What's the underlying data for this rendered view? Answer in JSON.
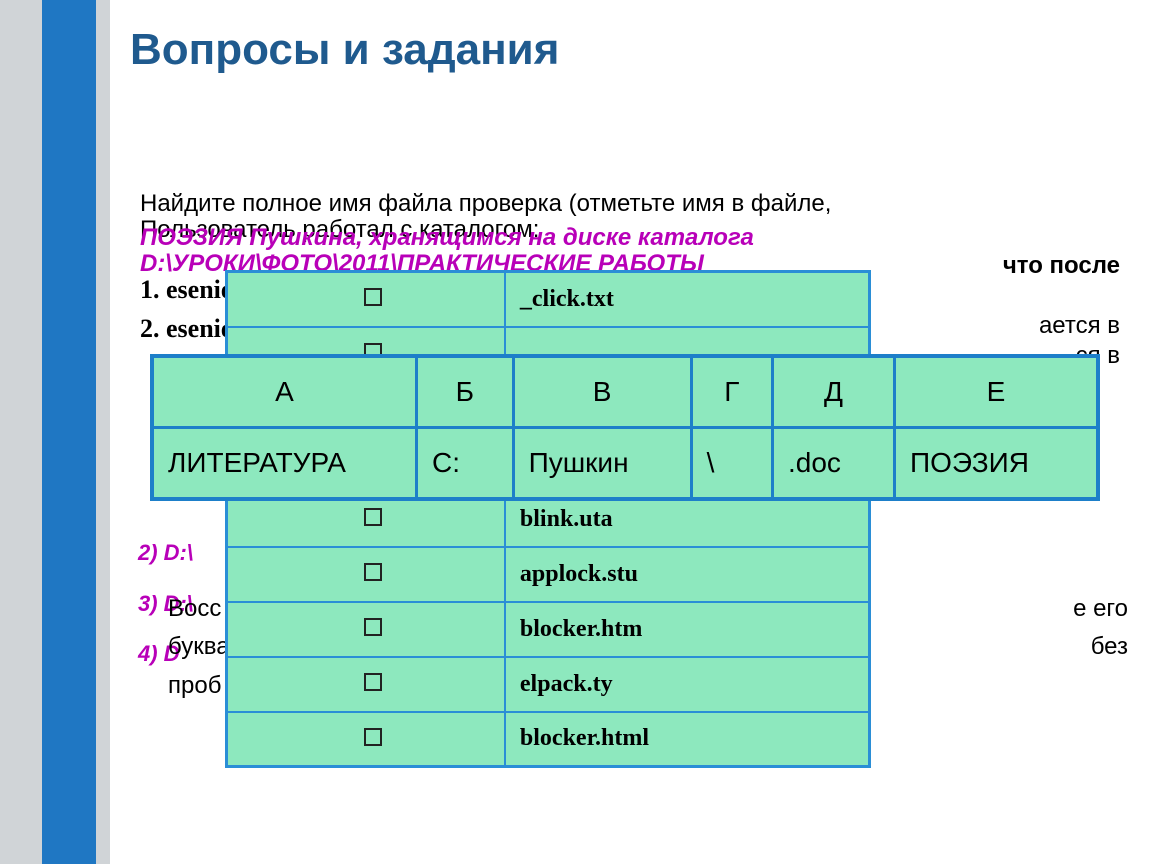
{
  "title": "Вопросы и задания",
  "bg_line1": "Найдите полное имя файла проверка (отметьте имя в файле,",
  "bg_line2": "Пользователь работал с каталогом:",
  "bg_line3": "ПОЭЗИЯ Пушкина, хранящимся на диске каталога",
  "bg_line4": "D:\\УРОКИ\\ФОТО\\2011\\ПРАКТИЧЕСКИЕ РАБОТЫ",
  "bg_line5": "что после",
  "bg_line6": "ается в",
  "bg_line7": "ся в",
  "numbered": [
    "2) D:\\",
    "3) D:\\",
    "4) D"
  ],
  "ess_rows": [
    "1. esenie.ttx",
    "2. esenie.ttx"
  ],
  "vosst_line1": "Восс",
  "vosst_line2": "е его",
  "vosst_line3": "буква",
  "vosst_line4": "без",
  "vosst_line5": "проб",
  "filetable": {
    "rows": [
      "_click.txt",
      "",
      "",
      "",
      "blink.uta",
      "applock.stu",
      "blocker.htm",
      "elpack.ty",
      "blocker.html"
    ]
  },
  "lettertable": {
    "headers": [
      "А",
      "Б",
      "В",
      "Г",
      "Д",
      "Е"
    ],
    "cells": [
      "ЛИТЕРАТУРА",
      "C:",
      "Пушкин",
      "\\",
      ".doc",
      "ПОЭЗИЯ"
    ]
  }
}
